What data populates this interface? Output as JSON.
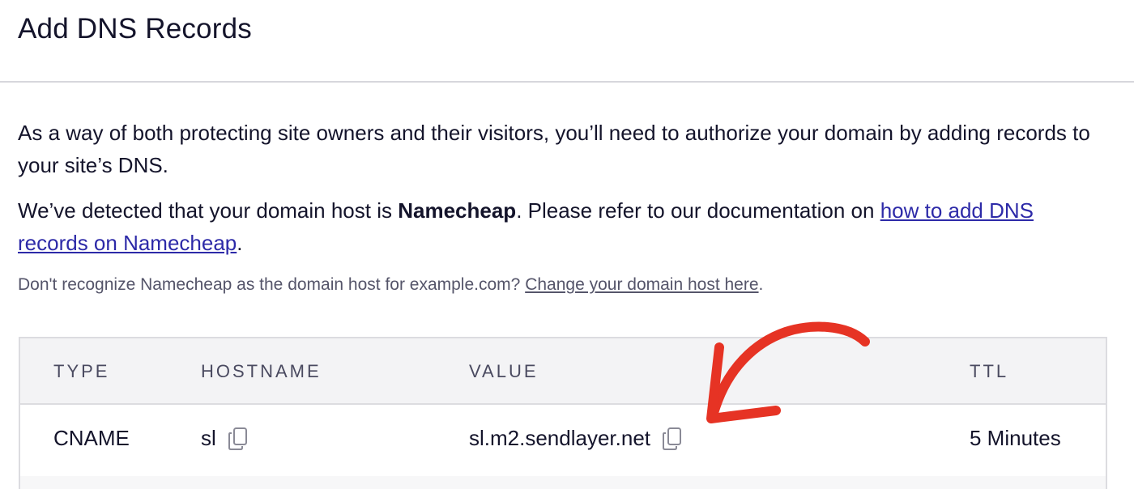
{
  "header": {
    "title": "Add DNS Records"
  },
  "intro": {
    "text": "As a way of both protecting site owners and their visitors, you’ll need to authorize your domain by adding records to your site’s DNS."
  },
  "detect": {
    "prefix": "We’ve detected that your domain host is ",
    "host": "Namecheap",
    "middle": ". Please refer to our documentation on ",
    "link": "how to add DNS records on Namecheap",
    "suffix": "."
  },
  "note": {
    "text": "Don't recognize Namecheap as the domain host for example.com? ",
    "link": "Change your domain host here",
    "suffix": "."
  },
  "table": {
    "columns": [
      "TYPE",
      "HOSTNAME",
      "VALUE",
      "TTL"
    ],
    "rows": [
      {
        "type": "CNAME",
        "hostname": "sl",
        "value": "sl.m2.sendlayer.net",
        "ttl": "5 Minutes"
      }
    ]
  },
  "icons": {
    "copy": "copy-icon",
    "annotation": "red-arrow-annotation"
  },
  "colors": {
    "link": "#2d2aa8",
    "arrow": "#e63324",
    "text": "#14142b"
  }
}
